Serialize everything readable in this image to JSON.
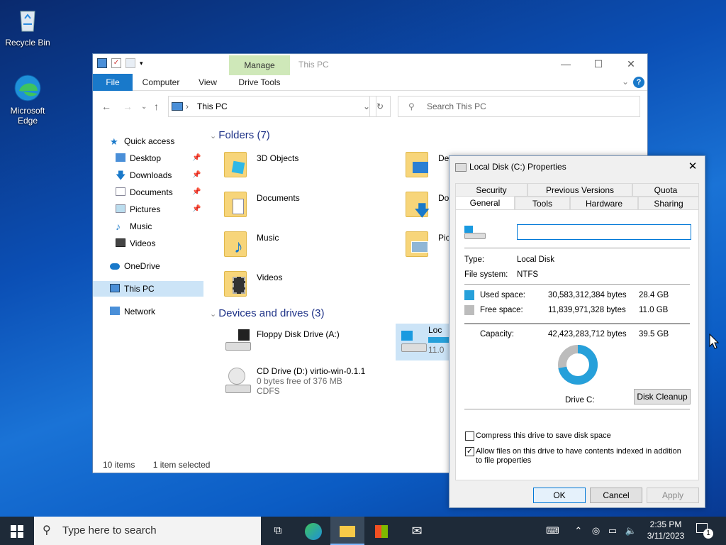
{
  "desktop": {
    "icons": [
      {
        "label": "Recycle Bin"
      },
      {
        "label": "Microsoft Edge"
      }
    ]
  },
  "explorer": {
    "title": "This PC",
    "ribbon": {
      "manage": "Manage",
      "tabs": [
        "File",
        "Computer",
        "View",
        "Drive Tools"
      ]
    },
    "address": "This PC",
    "search_placeholder": "Search This PC",
    "nav": {
      "quick_access": "Quick access",
      "items": [
        "Desktop",
        "Downloads",
        "Documents",
        "Pictures",
        "Music",
        "Videos"
      ],
      "onedrive": "OneDrive",
      "this_pc": "This PC",
      "network": "Network"
    },
    "folders_header": "Folders (7)",
    "folders": [
      "3D Objects",
      "Desktop",
      "Documents",
      "Downloads",
      "Music",
      "Pictures",
      "Videos"
    ],
    "devices_header": "Devices and drives (3)",
    "devices": {
      "floppy": "Floppy Disk Drive (A:)",
      "cd": {
        "name": "CD Drive (D:) virtio-win-0.1.1",
        "free": "0 bytes free of 376 MB",
        "fs": "CDFS"
      },
      "local": {
        "name": "Loc",
        "free": "11.0"
      }
    },
    "visible_folder_prefixes": {
      "desktop": "Des",
      "downloads": "Dov",
      "pictures": "Pict"
    },
    "status": {
      "items": "10 items",
      "selected": "1 item selected"
    }
  },
  "dialog": {
    "title": "Local Disk (C:) Properties",
    "tabs_row1": [
      "Security",
      "Previous Versions",
      "Quota"
    ],
    "tabs_row2": [
      "General",
      "Tools",
      "Hardware",
      "Sharing"
    ],
    "label_value": "",
    "type_label": "Type:",
    "type_value": "Local Disk",
    "fs_label": "File system:",
    "fs_value": "NTFS",
    "used_label": "Used space:",
    "used_bytes": "30,583,312,384 bytes",
    "used_gb": "28.4 GB",
    "free_label": "Free space:",
    "free_bytes": "11,839,971,328 bytes",
    "free_gb": "11.0 GB",
    "capacity_label": "Capacity:",
    "capacity_bytes": "42,423,283,712 bytes",
    "capacity_gb": "39.5 GB",
    "drive_label": "Drive C:",
    "cleanup": "Disk Cleanup",
    "compress": "Compress this drive to save disk space",
    "index": "Allow files on this drive to have contents indexed in addition to file properties",
    "used_fraction": 0.721,
    "colors": {
      "used": "#26a0da",
      "free": "#bcbcbc"
    },
    "ok": "OK",
    "cancel": "Cancel",
    "apply": "Apply"
  },
  "taskbar": {
    "search_placeholder": "Type here to search",
    "time": "2:35 PM",
    "date": "3/11/2023",
    "notification_count": "1"
  }
}
